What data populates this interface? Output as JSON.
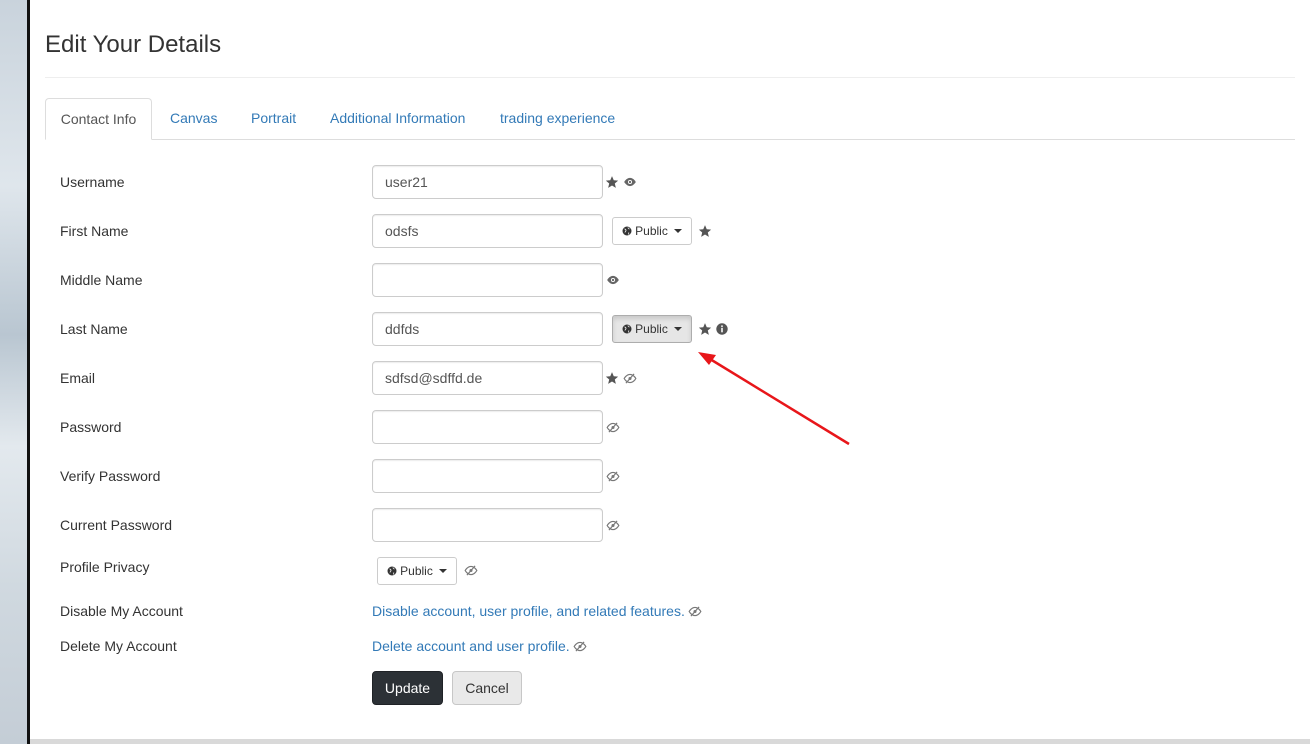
{
  "page": {
    "title": "Edit Your Details"
  },
  "tabs": [
    {
      "label": "Contact Info",
      "active": true
    },
    {
      "label": "Canvas"
    },
    {
      "label": "Portrait"
    },
    {
      "label": "Additional Information"
    },
    {
      "label": "trading experience"
    }
  ],
  "fields": {
    "username": {
      "label": "Username",
      "value": "user21"
    },
    "first_name": {
      "label": "First Name",
      "value": "odsfs",
      "privacy": "Public"
    },
    "middle_name": {
      "label": "Middle Name",
      "value": ""
    },
    "last_name": {
      "label": "Last Name",
      "value": "ddfds",
      "privacy": "Public"
    },
    "email": {
      "label": "Email",
      "value": "sdfsd@sdffd.de"
    },
    "password": {
      "label": "Password",
      "value": ""
    },
    "verify_password": {
      "label": "Verify Password",
      "value": ""
    },
    "current_password": {
      "label": "Current Password",
      "value": ""
    },
    "profile_privacy": {
      "label": "Profile Privacy",
      "privacy": "Public"
    },
    "disable_account": {
      "label": "Disable My Account",
      "link": "Disable account, user profile, and related features."
    },
    "delete_account": {
      "label": "Delete My Account",
      "link": "Delete account and user profile."
    }
  },
  "buttons": {
    "update": "Update",
    "cancel": "Cancel"
  },
  "colors": {
    "link": "#337ab7",
    "annotation_arrow": "#e8161a",
    "update_button": "#2c3136"
  },
  "icons": [
    "star-icon",
    "eye-icon",
    "eye-slash-icon",
    "globe-icon",
    "info-icon",
    "caret-down-icon"
  ]
}
